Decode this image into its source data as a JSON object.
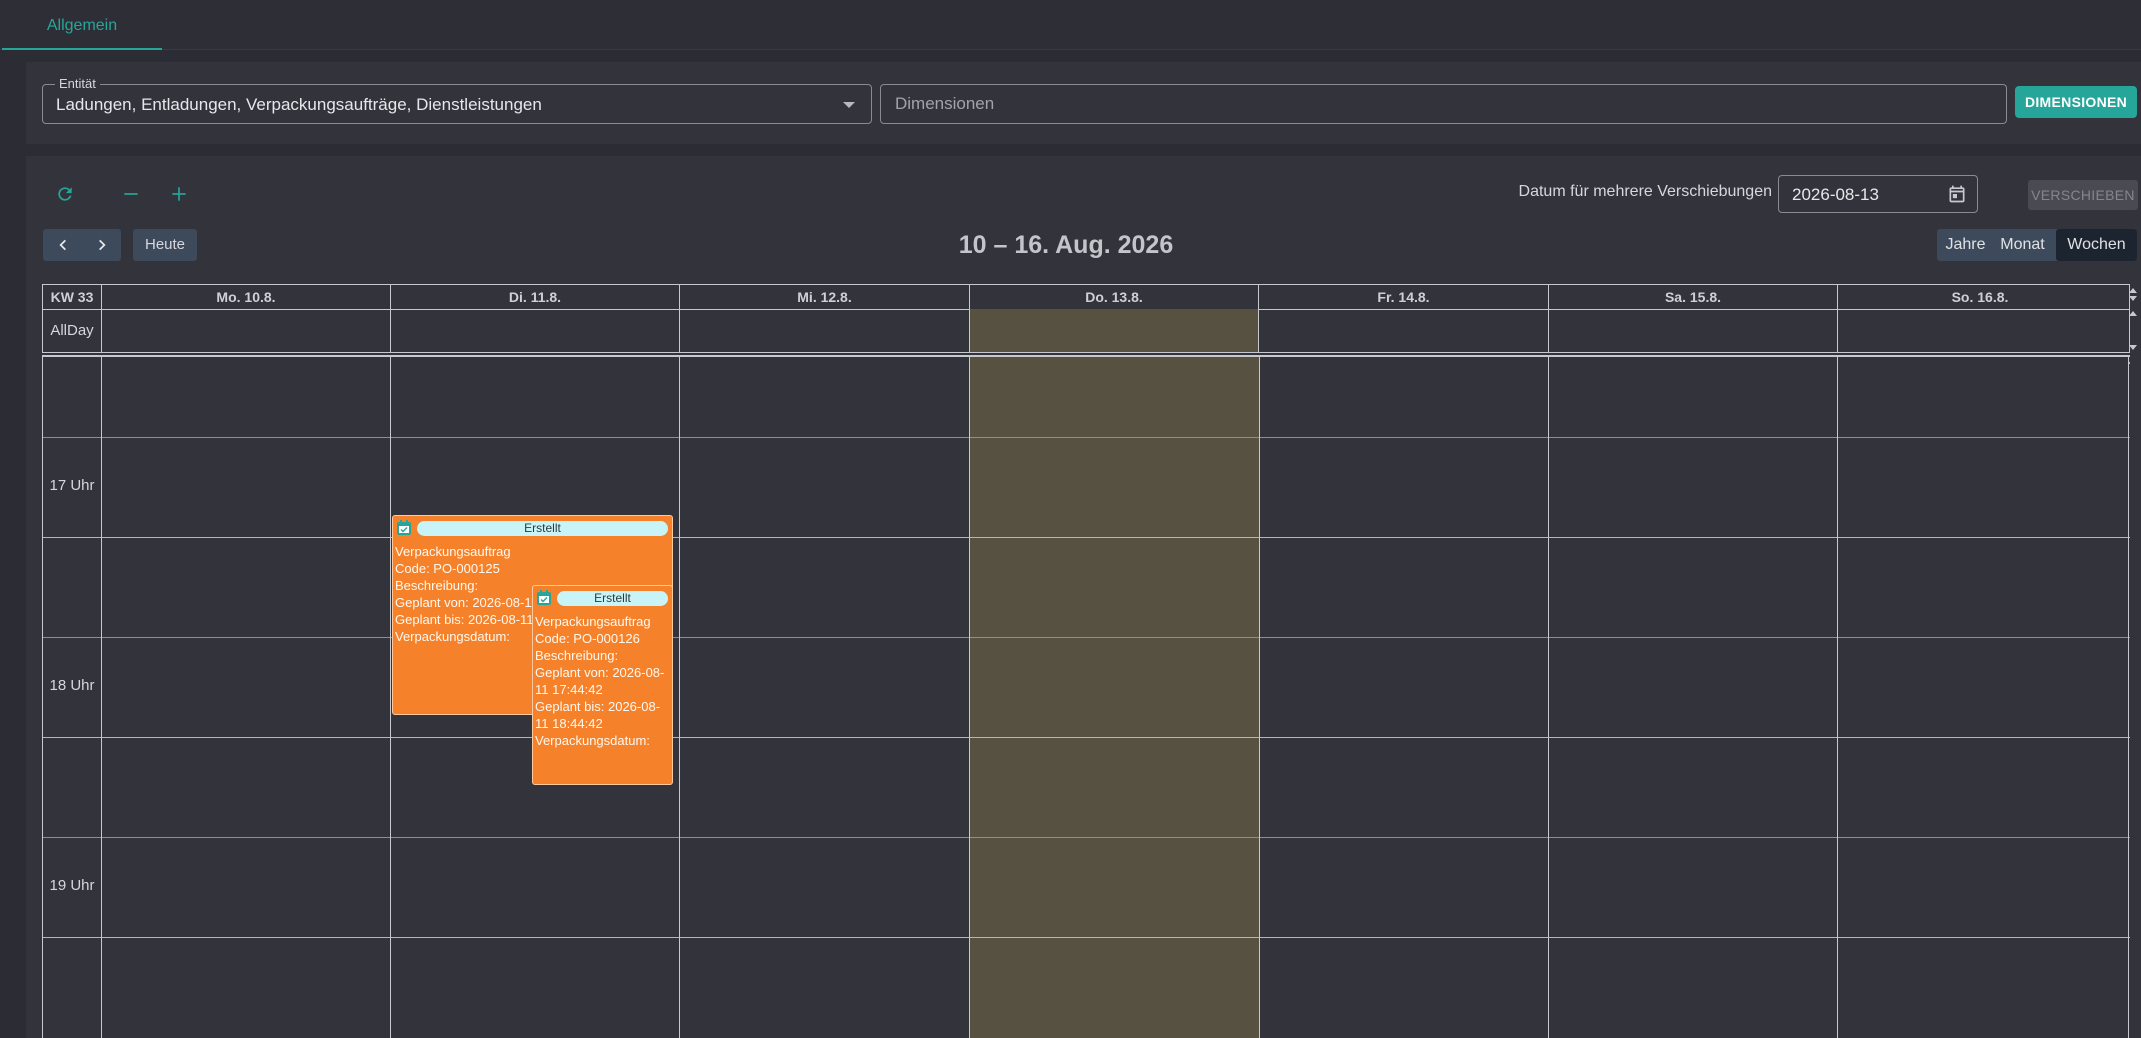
{
  "tabs": {
    "general": "Allgemein"
  },
  "filter": {
    "entity_label": "Entität",
    "entity_value": "Ladungen, Entladungen, Verpackungsaufträge, Dienstleistungen",
    "dimensions_placeholder": "Dimensionen",
    "dimensions_button": "DIMENSIONEN"
  },
  "toolbar": {
    "multi_move_label": "Datum für mehrere Verschiebungen",
    "move_date": "2026-08-13",
    "move_button": "VERSCHIEBEN",
    "today_button": "Heute",
    "range_title": "10 – 16. Aug. 2026",
    "views": {
      "year": "Jahre",
      "month": "Monat",
      "week": "Wochen"
    },
    "active_view": "week"
  },
  "calendar": {
    "week_label": "KW 33",
    "allday_label": "AllDay",
    "days": [
      "Mo. 10.8.",
      "Di. 11.8.",
      "Mi. 12.8.",
      "Do. 13.8.",
      "Fr. 14.8.",
      "Sa. 15.8.",
      "So. 16.8."
    ],
    "today_index": 3,
    "hours": [
      "17 Uhr",
      "18 Uhr",
      "19 Uhr"
    ],
    "today_color": "#575142"
  },
  "events": [
    {
      "status": "Erstellt",
      "type": "Verpackungsauftrag",
      "code": "Code: PO-000125",
      "description": "Beschreibung:",
      "planned_from": "Geplant von: 2026-08-11 17:44:42",
      "planned_to": "Geplant bis: 2026-08-11 18:44:42",
      "packing_date": "Verpackungsdatum:",
      "color": "#f5822a"
    },
    {
      "status": "Erstellt",
      "type": "Verpackungsauftrag",
      "code": "Code: PO-000126",
      "description": "Beschreibung:",
      "planned_from": "Geplant von: 2026-08-11 17:44:42",
      "planned_to": "Geplant bis: 2026-08-11 18:44:42",
      "packing_date": "Verpackungsdatum:",
      "color": "#f5822a"
    }
  ],
  "colors": {
    "accent": "#26a69a",
    "background": "#2c2d34",
    "panel": "#33343b"
  }
}
